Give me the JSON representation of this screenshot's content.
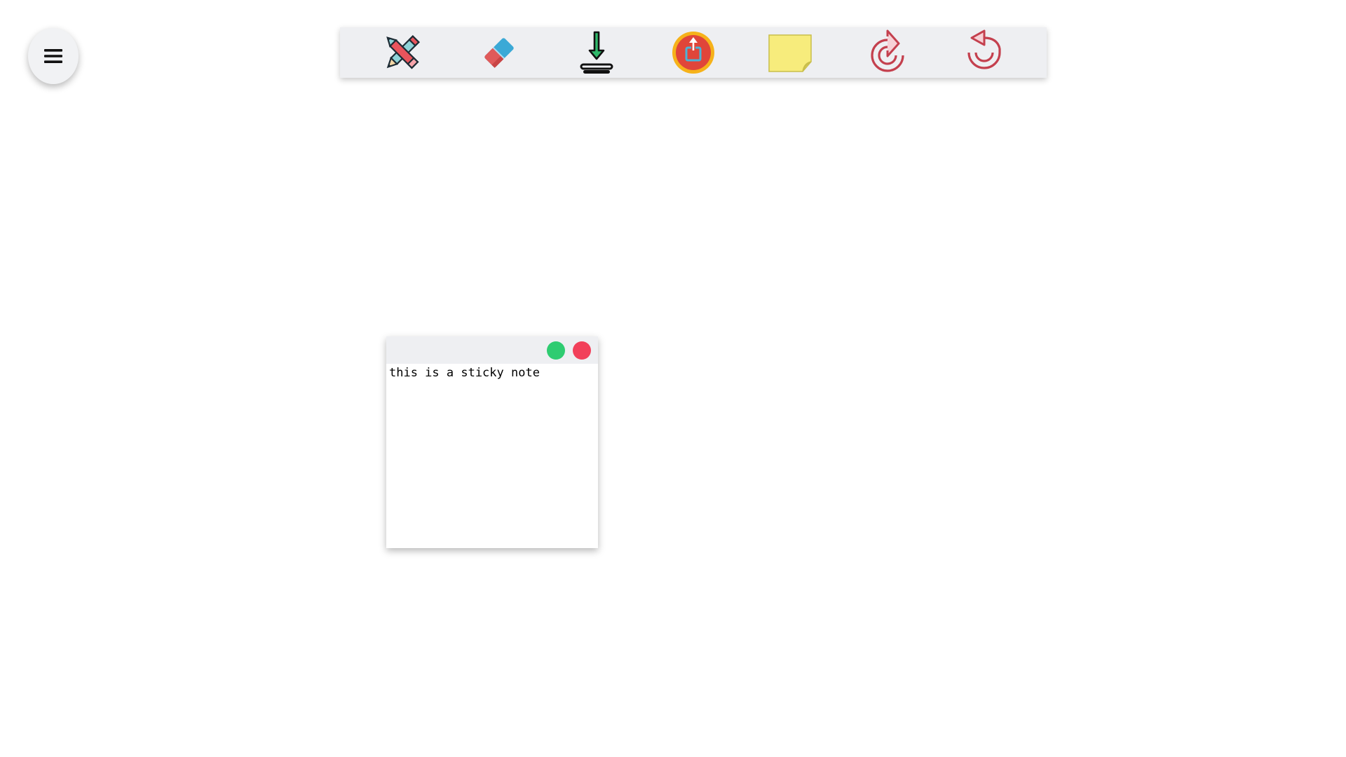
{
  "menu": {
    "icon": "hamburger-menu-icon"
  },
  "toolbar": {
    "tools": [
      {
        "name": "pencil-tool",
        "icon": "crossed-pencils-icon"
      },
      {
        "name": "eraser-tool",
        "icon": "eraser-icon"
      },
      {
        "name": "download-tool",
        "icon": "download-icon"
      },
      {
        "name": "upload-tool",
        "icon": "upload-icon"
      },
      {
        "name": "sticky-note-tool",
        "icon": "sticky-note-icon"
      },
      {
        "name": "redo-tool",
        "icon": "redo-icon"
      },
      {
        "name": "undo-tool",
        "icon": "undo-icon"
      }
    ]
  },
  "sticky_note": {
    "text": "this is a sticky note",
    "buttons": [
      {
        "name": "note-add-button",
        "color": "#2ecc71"
      },
      {
        "name": "note-close-button",
        "color": "#f2405a"
      }
    ]
  },
  "colors": {
    "toolbar_bg": "#eeeff2",
    "canvas_bg": "#ffffff",
    "green": "#2ecc71",
    "red": "#f2405a",
    "sticky_yellow": "#f7ec7c"
  }
}
